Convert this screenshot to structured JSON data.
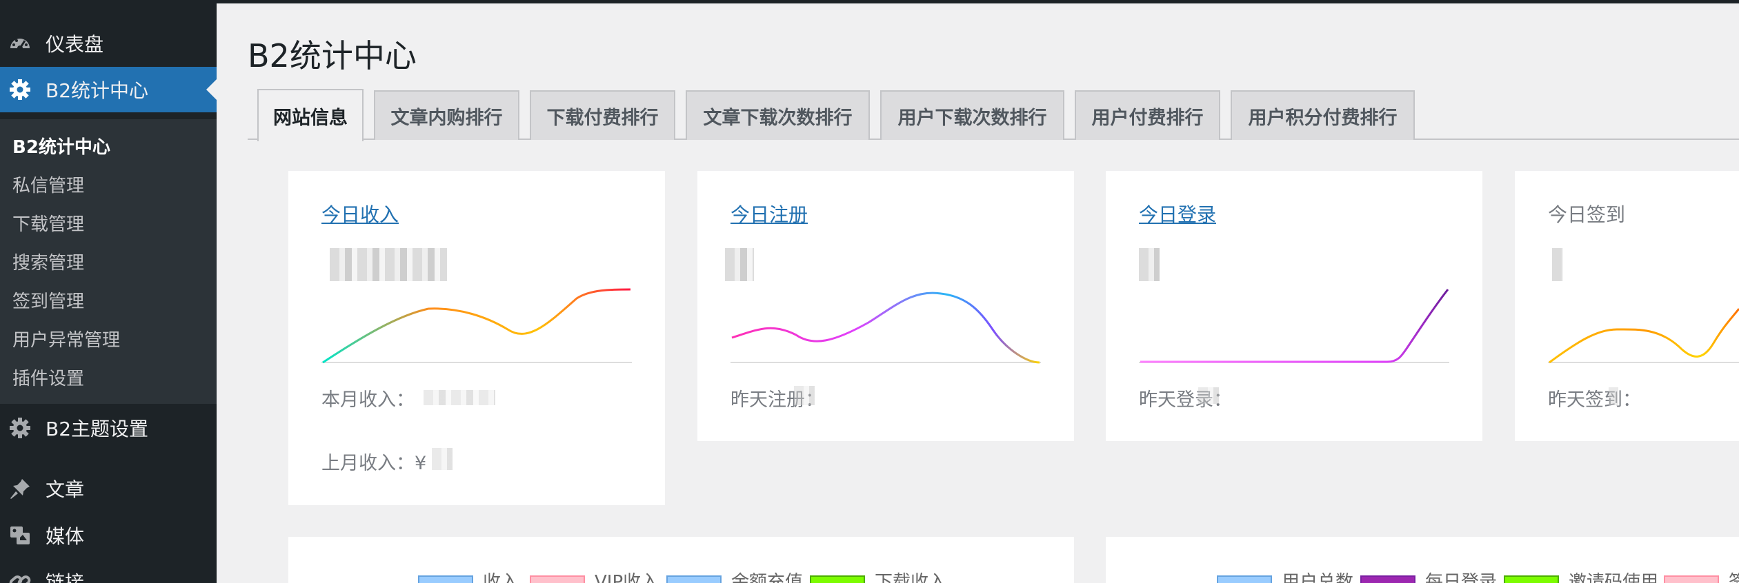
{
  "sidebar": {
    "dashboard": "仪表盘",
    "b2stats": "B2统计中心",
    "submenu": [
      "B2统计中心",
      "私信管理",
      "下载管理",
      "搜索管理",
      "签到管理",
      "用户异常管理",
      "插件设置"
    ],
    "theme_settings": "B2主题设置",
    "posts": "文章",
    "media": "媒体",
    "links": "链接"
  },
  "page": {
    "title": "B2统计中心"
  },
  "tabs": [
    "网站信息",
    "文章内购排行",
    "下载付费排行",
    "文章下载次数排行",
    "用户下载次数排行",
    "用户付费排行",
    "用户积分付费排行"
  ],
  "cards": [
    {
      "title": "今日收入",
      "footer1": "本月收入：",
      "footer2": "上月收入：¥"
    },
    {
      "title": "今日注册",
      "footer1": "昨天注册："
    },
    {
      "title": "今日登录",
      "footer1": "昨天登录："
    },
    {
      "title": "今日签到",
      "footer1": "昨天签到："
    }
  ],
  "legend_left": [
    {
      "label": "收入",
      "color": "#99ccff"
    },
    {
      "label": "VIP收入",
      "color": "#ffc0cb"
    },
    {
      "label": "余额充值",
      "color": "#99ccff"
    },
    {
      "label": "下载收入",
      "color": "#7cfc00"
    }
  ],
  "legend_right": [
    {
      "label": "用户总数",
      "color": "#99ccff"
    },
    {
      "label": "每日登录",
      "color": "#9c27b0"
    },
    {
      "label": "邀请码使用",
      "color": "#7cfc00"
    },
    {
      "label": "签",
      "color": "#ffc0cb"
    }
  ],
  "colors": {
    "accent": "#2271b1",
    "sidebar": "#1d2327",
    "submenu": "#2c3338"
  }
}
